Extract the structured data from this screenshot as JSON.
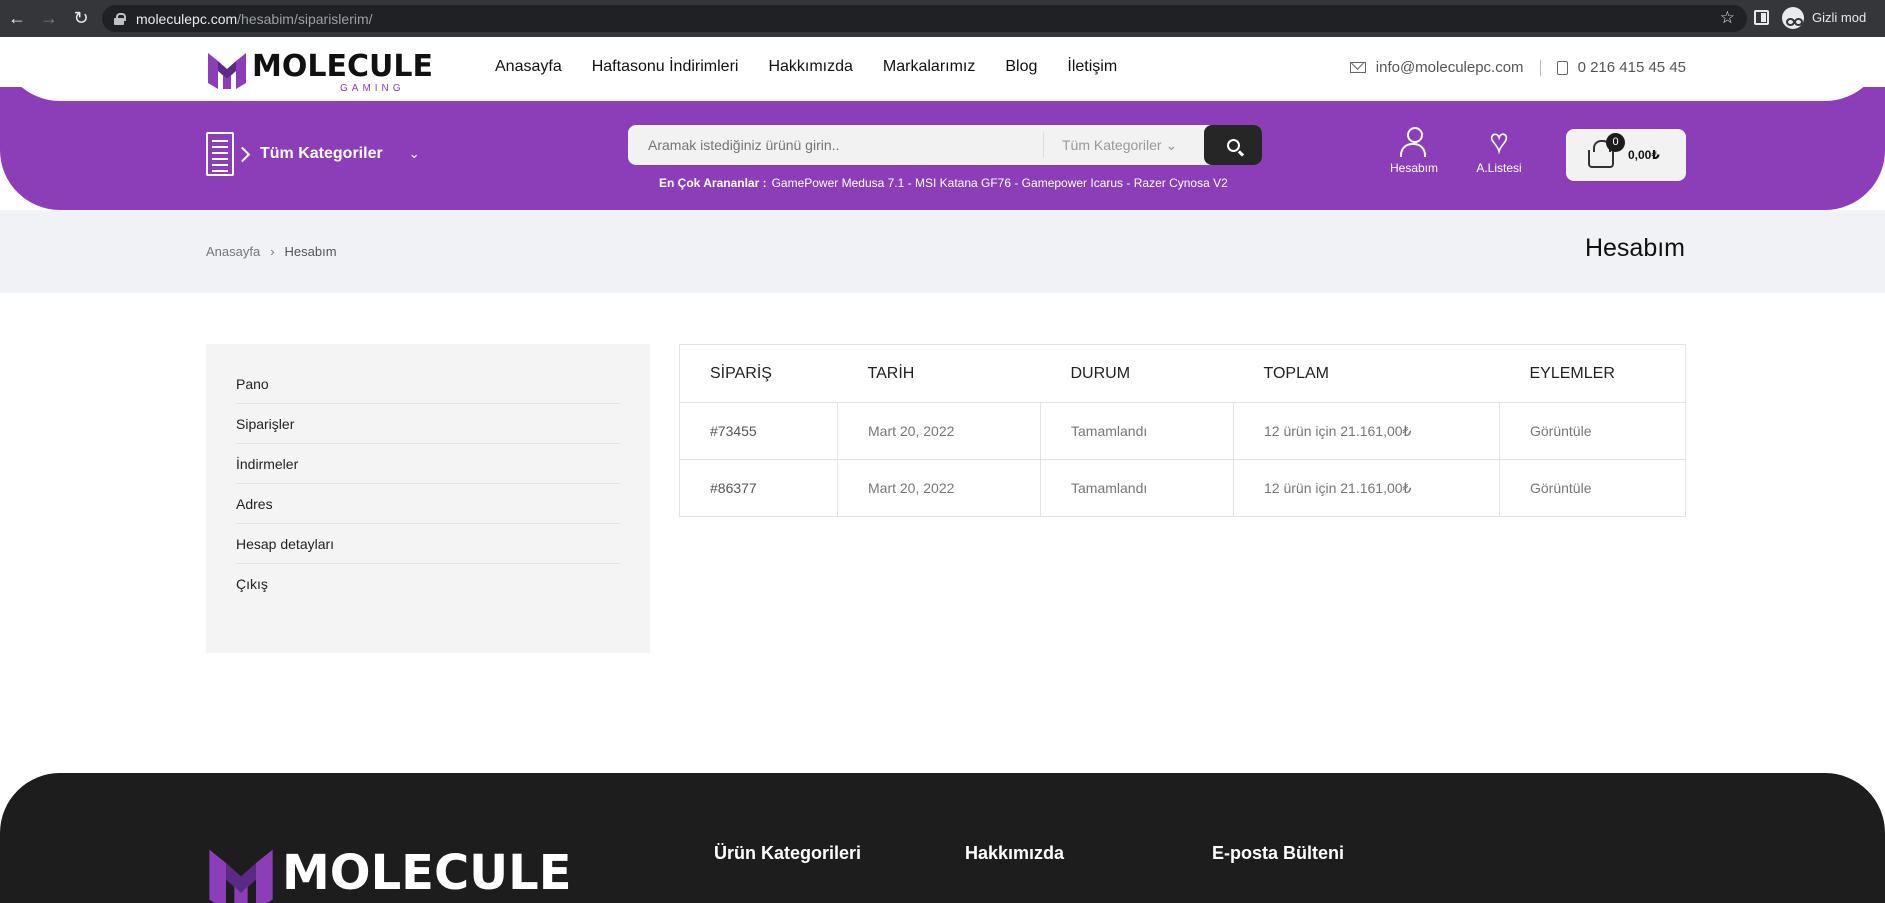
{
  "browser": {
    "url_host": "moleculepc.com",
    "url_path": "/hesabim/siparislerim/",
    "incognito_label": "Gizli mod"
  },
  "brand": {
    "name": "MOLECULE",
    "tagline": "GAMING",
    "accent": "#8b3eb7"
  },
  "nav": {
    "items": [
      "Anasayfa",
      "Haftasonu İndirimleri",
      "Hakkımızda",
      "Markalarımız",
      "Blog",
      "İletişim"
    ],
    "email": "info@moleculepc.com",
    "phone": "0 216 415 45 45"
  },
  "header": {
    "categories_label": "Tüm Kategoriler",
    "search_placeholder": "Aramak istediğiniz ürünü girin..",
    "search_category": "Tüm Kategoriler",
    "popular_label": "En Çok Arananlar :",
    "popular_terms": "GamePower Medusa 7.1 - MSI Katana GF76 - Gamepower Icarus - Razer Cynosa V2",
    "account_label": "Hesabım",
    "wishlist_label": "A.Listesi",
    "cart_count": "0",
    "cart_total": "0,00₺"
  },
  "breadcrumb": {
    "home": "Anasayfa",
    "separator": "›",
    "current": "Hesabım",
    "page_title": "Hesabım"
  },
  "sidebar": {
    "items": [
      "Pano",
      "Siparişler",
      "İndirmeler",
      "Adres",
      "Hesap detayları",
      "Çıkış"
    ]
  },
  "orders": {
    "columns": [
      "SİPARİŞ",
      "TARİH",
      "DURUM",
      "TOPLAM",
      "EYLEMLER"
    ],
    "rows": [
      {
        "id": "#73455",
        "date": "Mart 20, 2022",
        "status": "Tamamlandı",
        "total": "12 ürün için 21.161,00₺",
        "action": "Görüntüle"
      },
      {
        "id": "#86377",
        "date": "Mart 20, 2022",
        "status": "Tamamlandı",
        "total": "12 ürün için 21.161,00₺",
        "action": "Görüntüle"
      }
    ]
  },
  "footer": {
    "headings": [
      "Ürün Kategorileri",
      "Hakkımızda",
      "E-posta Bülteni"
    ]
  }
}
